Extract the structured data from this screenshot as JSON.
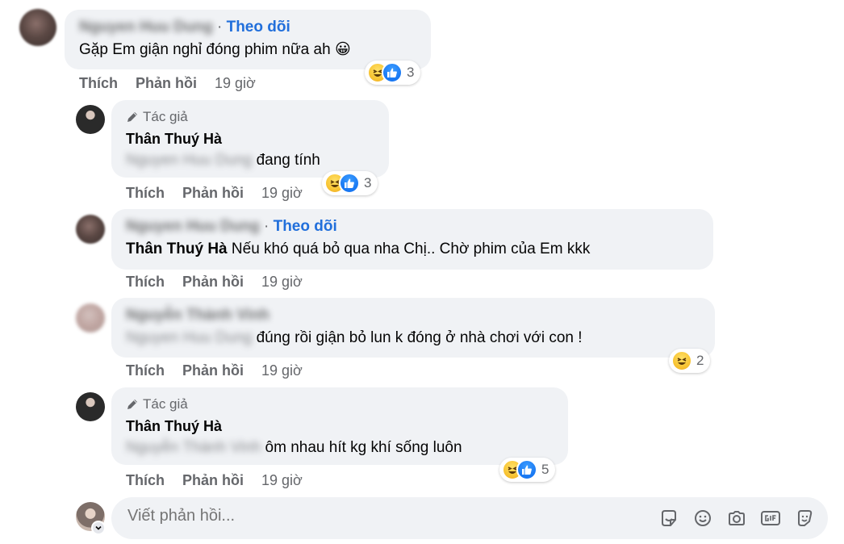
{
  "comments": [
    {
      "blurred_name": "Nguyen Huu Dung",
      "follow_label": "Theo dõi",
      "text": "Gặp Em giận nghỉ đóng phim nữa ah",
      "emoji": "😀",
      "reaction_count": "3",
      "actions": {
        "like": "Thích",
        "reply": "Phản hồi",
        "time": "19 giờ"
      }
    },
    {
      "author_tag": "Tác giả",
      "name": "Thân Thuý Hà",
      "blurred_mention": "Nguyen Huu Dung",
      "text": "đang tính",
      "reaction_count": "3",
      "actions": {
        "like": "Thích",
        "reply": "Phản hồi",
        "time": "19 giờ"
      }
    },
    {
      "blurred_name": "Nguyen Huu Dung",
      "follow_label": "Theo dõi",
      "mention": "Thân Thuý Hà",
      "text": "Nếu khó quá bỏ qua nha Chị.. Chờ phim của Em kkk",
      "actions": {
        "like": "Thích",
        "reply": "Phản hồi",
        "time": "19 giờ"
      }
    },
    {
      "blurred_name": "Nguyễn Thành Vinh",
      "blurred_mention": "Nguyen Huu Dung",
      "text": "đúng rồi giận bỏ lun k đóng ở nhà chơi với con !",
      "reaction_count": "2",
      "actions": {
        "like": "Thích",
        "reply": "Phản hồi",
        "time": "19 giờ"
      }
    },
    {
      "author_tag": "Tác giả",
      "name": "Thân Thuý Hà",
      "blurred_mention": "Nguyễn Thành Vinh",
      "text": "ôm nhau hít kg khí sống luôn",
      "reaction_count": "5",
      "actions": {
        "like": "Thích",
        "reply": "Phản hồi",
        "time": "19 giờ"
      }
    }
  ],
  "reply_box": {
    "placeholder": "Viết phản hồi...",
    "tools": [
      "sticker-icon",
      "emoji-icon",
      "camera-icon",
      "gif-icon",
      "avatar-sticker-icon"
    ]
  },
  "colors": {
    "link": "#216fdb",
    "bubble": "#f0f2f5",
    "meta": "#65676b",
    "like": "#1877f2",
    "haha": "#f8c534"
  }
}
